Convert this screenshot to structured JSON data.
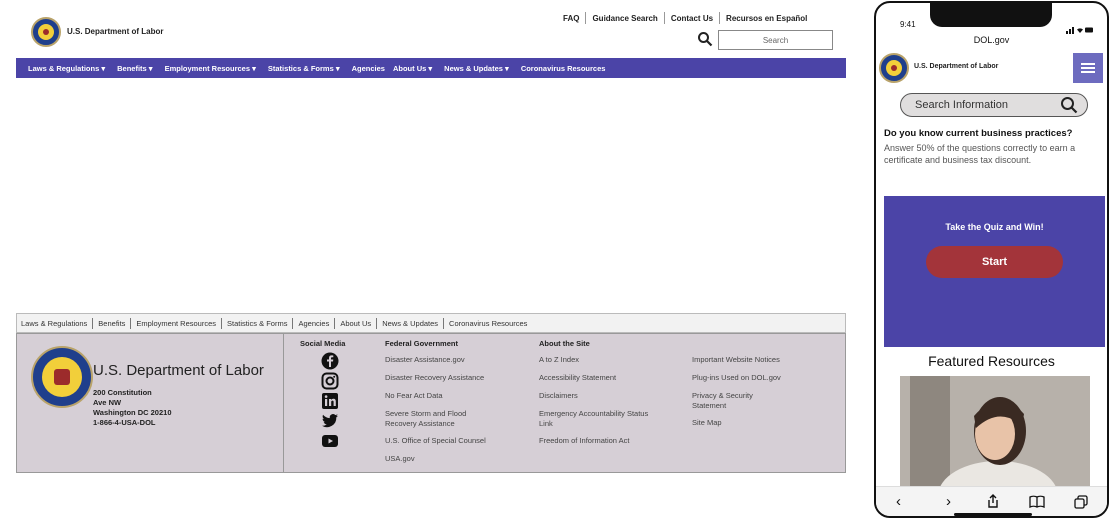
{
  "desktop": {
    "agency_name": "U.S. Department of Labor",
    "utility_links": [
      "FAQ",
      "Guidance Search",
      "Contact Us",
      "Recursos en Español"
    ],
    "search_placeholder": "Search",
    "nav": [
      {
        "label": "Laws & Regulations",
        "caret": true
      },
      {
        "label": "Benefits",
        "caret": true
      },
      {
        "label": "Employment Resources",
        "caret": true
      },
      {
        "label": "Statistics & Forms",
        "caret": true
      },
      {
        "label": "Agencies",
        "caret": false
      },
      {
        "label": "About Us",
        "caret": true
      },
      {
        "label": "News & Updates",
        "caret": true
      },
      {
        "label": "Coronavirus Resources",
        "caret": false
      }
    ],
    "footer_links": [
      "Laws & Regulations",
      "Benefits",
      "Employment Resources",
      "Statistics & Forms",
      "Agencies",
      "About Us",
      "News & Updates",
      "Coronavirus Resources"
    ],
    "footer": {
      "org_name": "U.S. Department of Labor",
      "address": [
        "200 Constitution",
        "Ave NW",
        "Washington DC 20210",
        "1-866-4-USA-DOL"
      ],
      "social_heading": "Social Media",
      "social_icons": [
        "facebook-icon",
        "instagram-icon",
        "linkedin-icon",
        "twitter-icon",
        "youtube-icon"
      ],
      "federal_heading": "Federal Government",
      "federal_links": [
        "Disaster Assistance.gov",
        "Disaster Recovery Assistance",
        "No Fear Act Data",
        "Severe Storm and Flood Recovery Assistance",
        "U.S. Office of Special Counsel",
        "USA.gov"
      ],
      "about_heading": "About the Site",
      "about_links": [
        "A to Z Index",
        "Accessibility Statement",
        "Disclaimers",
        "Emergency Accountability Status Link",
        "Freedom of Information Act"
      ],
      "extra_links": [
        "Important Website Notices",
        "Plug-ins Used on DOL.gov",
        "Privacy & Security Statement",
        "Site Map"
      ]
    }
  },
  "mobile": {
    "time": "9:41",
    "url": "DOL.gov",
    "agency_name": "U.S. Department of Labor",
    "search_placeholder": "Search Information",
    "question": "Do you know current business practices?",
    "question_sub": "Answer 50% of the questions correctly to earn a certificate and business tax discount.",
    "quiz_title": "Take the Quiz and Win!",
    "start_label": "Start",
    "featured_title": "Featured Resources"
  },
  "colors": {
    "nav_purple": "#4b44a7",
    "footer_bg": "#d6cfd6",
    "start_button": "#a3343a"
  }
}
